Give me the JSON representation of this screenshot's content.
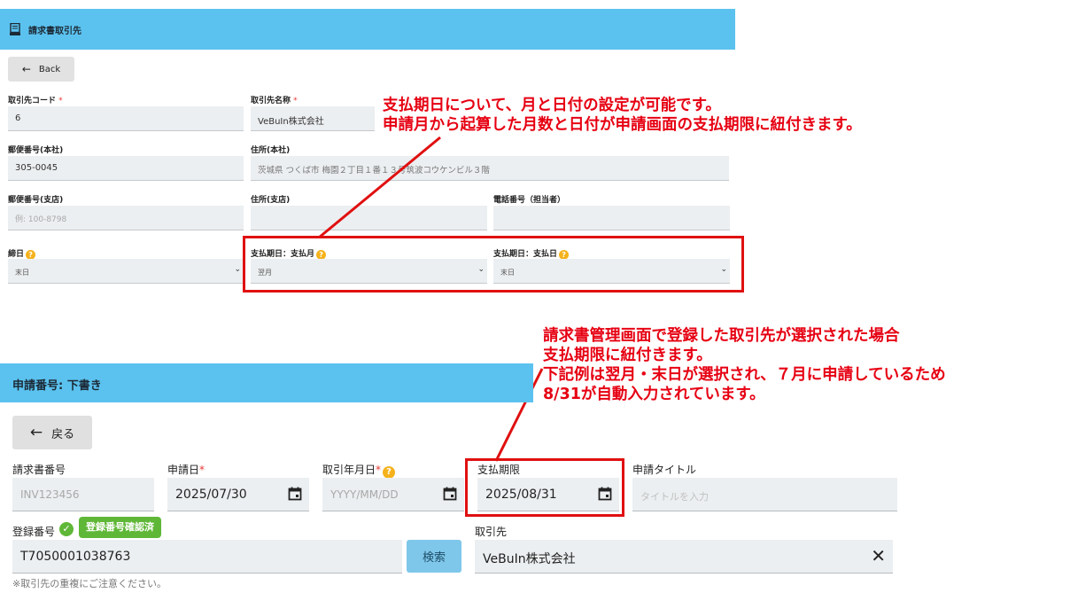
{
  "upper": {
    "header_title": "請求書取引先",
    "back_label": "Back",
    "fields": {
      "code_label": "取引先コード",
      "code_value": "6",
      "name_label": "取引先名称",
      "name_value": "VeBuIn株式会社",
      "zip_main_label": "郵便番号(本社)",
      "zip_main_value": "305-0045",
      "address_main_label": "住所(本社)",
      "address_main_value": "茨城県 つくば市 梅園２丁目１番１３号筑波コウケンビル３階",
      "zip_branch_label": "郵便番号(支店)",
      "zip_branch_placeholder": "例: 100-8798",
      "address_branch_label": "住所(支店)",
      "phone_label": "電話番号（担当者）",
      "closing_label": "締日",
      "closing_value": "末日",
      "pay_month_label": "支払期日：支払月",
      "pay_month_value": "翌月",
      "pay_day_label": "支払期日：支払日",
      "pay_day_value": "末日",
      "required_mark": "*"
    }
  },
  "annotations": {
    "top_line1": "支払期日について、月と日付の設定が可能です。",
    "top_line2": "申請月から起算した月数と日付が申請画面の支払期限に紐付きます。",
    "bottom_line1": "請求書管理画面で登録した取引先が選択された場合",
    "bottom_line2": "支払期限に紐付きます。",
    "bottom_line3": "下記例は翌月・末日が選択され、７月に申請しているため",
    "bottom_line4": "8/31が自動入力されています。"
  },
  "lower": {
    "header_title": "申請番号: 下書き",
    "back_label": "戻る",
    "invoice_no_label": "請求書番号",
    "invoice_no_placeholder": "INV123456",
    "apply_date_label": "申請日",
    "apply_date_value": "2025/07/30",
    "txn_date_label": "取引年月日",
    "txn_date_placeholder": "YYYY/MM/DD",
    "due_label": "支払期限",
    "due_value": "2025/08/31",
    "title_label": "申請タイトル",
    "title_placeholder": "タイトルを入力",
    "reg_no_label": "登録番号",
    "verified_badge": "登録番号確認済",
    "reg_no_value": "T7050001038763",
    "search_label": "検索",
    "partner_label": "取引先",
    "partner_value": "VeBuIn株式会社",
    "note": "※取引先の重複にご注意ください。",
    "required_mark": "*"
  },
  "colors": {
    "header_bg": "#5bc2ef",
    "annotation_red": "#e60012",
    "verified_green": "#5fb737",
    "help_orange": "#f5b21b"
  }
}
